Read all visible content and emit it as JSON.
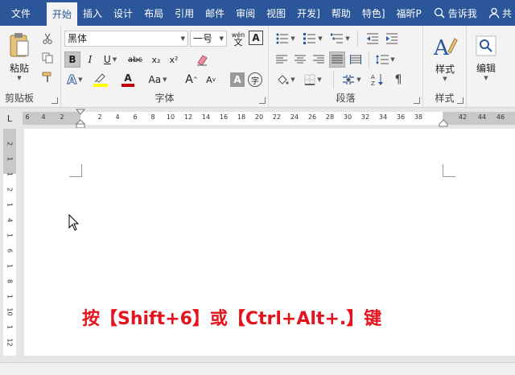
{
  "tabs": [
    {
      "label": "文件"
    },
    {
      "label": "开始"
    },
    {
      "label": "插入"
    },
    {
      "label": "设计"
    },
    {
      "label": "布局"
    },
    {
      "label": "引用"
    },
    {
      "label": "邮件"
    },
    {
      "label": "审阅"
    },
    {
      "label": "视图"
    },
    {
      "label": "开发]"
    },
    {
      "label": "帮助"
    },
    {
      "label": "特色]"
    },
    {
      "label": "福昕P"
    }
  ],
  "tell_me": "告诉我",
  "share": "共",
  "clipboard": {
    "paste": "粘贴",
    "label": "剪贴板"
  },
  "font": {
    "name": "黑体",
    "size": "一号",
    "label": "字体",
    "bold": "B",
    "italic": "I",
    "underline": "U",
    "strike": "abc",
    "sub": "x₂",
    "sup": "x²",
    "font_color": "A",
    "case": "Aa",
    "grow": "A",
    "shrink": "A",
    "charshade": "A",
    "enclose": "字",
    "phonetic": "wén\n文"
  },
  "paragraph": {
    "label": "段落"
  },
  "styles": {
    "button": "样式",
    "label": "样式"
  },
  "editing": {
    "button": "编辑"
  },
  "ruler_ticks": [
    "6",
    "4",
    "2",
    "2",
    "4",
    "6",
    "8",
    "10",
    "12",
    "14",
    "16",
    "18",
    "20",
    "22",
    "24",
    "26",
    "28",
    "30",
    "32",
    "34",
    "36",
    "38",
    "42",
    "44",
    "46"
  ],
  "vruler_ticks": [
    "2",
    "1",
    "1",
    "2",
    "1",
    "4",
    "1",
    "6",
    "1",
    "8",
    "1",
    "10",
    "1",
    "12"
  ],
  "document": {
    "hint": "按【Shift+6】或【Ctrl+Alt+.】键"
  },
  "colors": {
    "accent": "#2b579a",
    "hint": "#e4131c",
    "highlight": "#ffff00",
    "font_color": "#c00000"
  }
}
